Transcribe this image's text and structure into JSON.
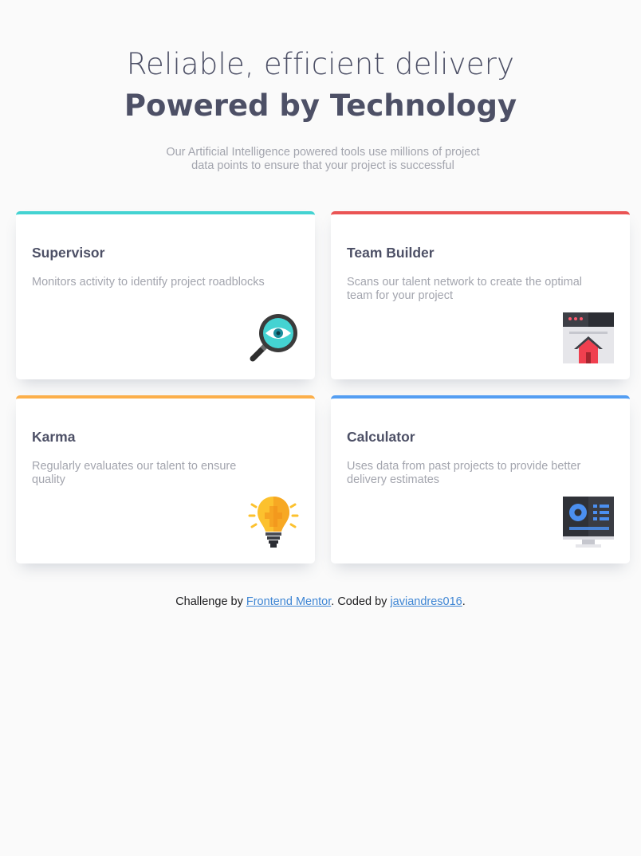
{
  "hero": {
    "title_light": "Reliable, efficient delivery",
    "title_bold": "Powered by Technology",
    "description": "Our Artificial Intelligence powered tools use millions of project data points to ensure that your project is successful"
  },
  "cards": [
    {
      "title": "Supervisor",
      "description": "Monitors activity to identify project roadblocks",
      "icon": "magnifier-eye-icon",
      "accent": "#44d3d2"
    },
    {
      "title": "Team Builder",
      "description": "Scans our talent network to create the optimal team for your project",
      "icon": "browser-house-icon",
      "accent": "#ea5454"
    },
    {
      "title": "Karma",
      "description": "Regularly evaluates our talent to ensure quality",
      "icon": "lightbulb-icon",
      "accent": "#fcaf4a"
    },
    {
      "title": "Calculator",
      "description": "Uses data from past projects to provide better delivery estimates",
      "icon": "monitor-icon",
      "accent": "#549ef2"
    }
  ],
  "footer": {
    "prefix": "Challenge by ",
    "link1": "Frontend Mentor",
    "middle": ". Coded by ",
    "link2": "javiandres016",
    "suffix": "."
  }
}
